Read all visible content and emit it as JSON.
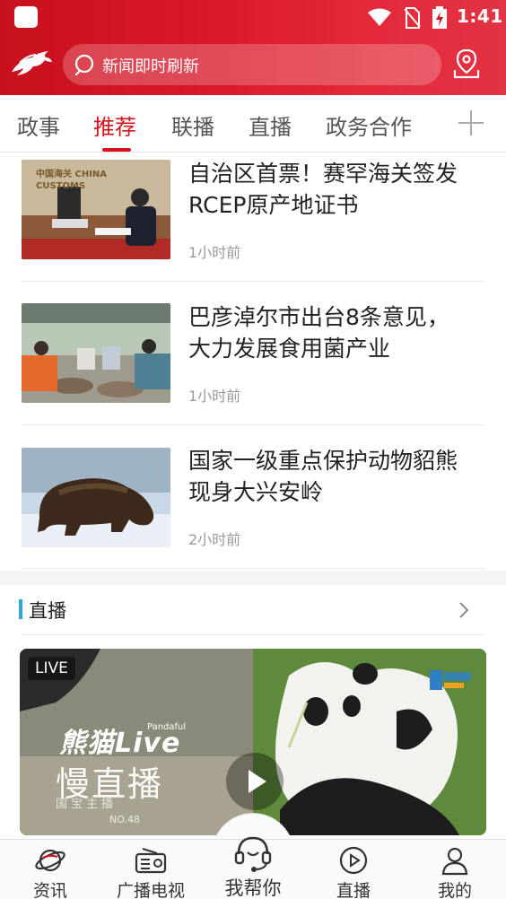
{
  "status_bar": {
    "time": "1:41"
  },
  "header": {
    "search_placeholder": "新闻即时刷新"
  },
  "tabs": [
    {
      "label": "政事"
    },
    {
      "label": "推荐"
    },
    {
      "label": "联播"
    },
    {
      "label": "直播"
    },
    {
      "label": "政务合作"
    }
  ],
  "active_tab": "推荐",
  "news": [
    {
      "title_line1": "自治区首票！赛罕海关签发",
      "title_line2": "RCEP原产地证书",
      "time": "1小时前",
      "thumb_text": "中国海关 CHINA CUSTOMS"
    },
    {
      "title_line1": "巴彦淖尔市出台8条意见，",
      "title_line2": "大力发展食用菌产业",
      "time": "1小时前"
    },
    {
      "title_line1": "国家一级重点保护动物貂熊",
      "title_line2": "现身大兴安岭",
      "time": "2小时前"
    }
  ],
  "live_section": {
    "title": "直播",
    "badge": "LIVE",
    "video_title1": "熊猫Live",
    "video_title2": "慢直播",
    "video_tag": "Pandaful",
    "video_no": "NO.48",
    "video_sub": "国宝主播"
  },
  "bottom_nav": [
    {
      "label": "资讯",
      "icon": "planet-icon"
    },
    {
      "label": "广播电视",
      "icon": "radio-icon"
    },
    {
      "label": "我帮你",
      "icon": "headset-icon"
    },
    {
      "label": "直播",
      "icon": "play-circle-icon"
    },
    {
      "label": "我的",
      "icon": "user-icon"
    }
  ],
  "colors": {
    "brand_red": "#d3141f",
    "accent_blue": "#2aa7e0"
  }
}
